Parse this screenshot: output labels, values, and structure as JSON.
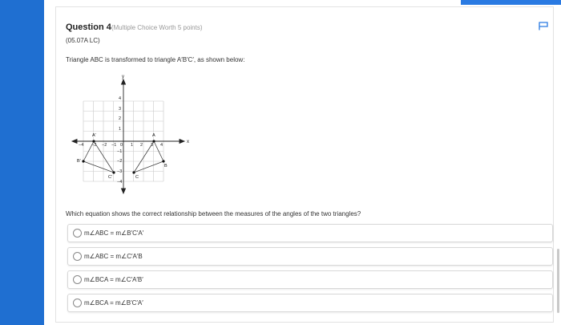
{
  "question": {
    "title": "Question 4",
    "worth": "(Multiple Choice Worth 5 points)",
    "code": "(05.07A LC)",
    "prompt": "Triangle ABC is transformed to triangle A′B′C′, as shown below:",
    "ask": "Which equation shows the correct relationship between the measures of the angles of the two triangles?"
  },
  "choices": [
    {
      "label": "m∠ABC  =  m∠B′C′A′"
    },
    {
      "label": "m∠ABC  =  m∠C′A′B"
    },
    {
      "label": "m∠BCA  =  m∠C′A′B′"
    },
    {
      "label": "m∠BCA  =  m∠B′C′A′"
    }
  ],
  "graph": {
    "axis_x": "x",
    "axis_y": "y",
    "x_ticks": [
      "−4",
      "−3",
      "−2",
      "−1",
      "0",
      "1",
      "2",
      "3",
      "4"
    ],
    "y_ticks": [
      "4",
      "3",
      "2",
      "1",
      "−1",
      "−2",
      "−3",
      "−4"
    ],
    "points": {
      "A": "A",
      "B": "B",
      "C": "C",
      "A_prime": "A′",
      "B_prime": "B′",
      "C_prime": "C′"
    }
  },
  "colors": {
    "sidebar": "#1f6fd1",
    "accent": "#2a7ae2",
    "flag": "#2a7ae2"
  }
}
